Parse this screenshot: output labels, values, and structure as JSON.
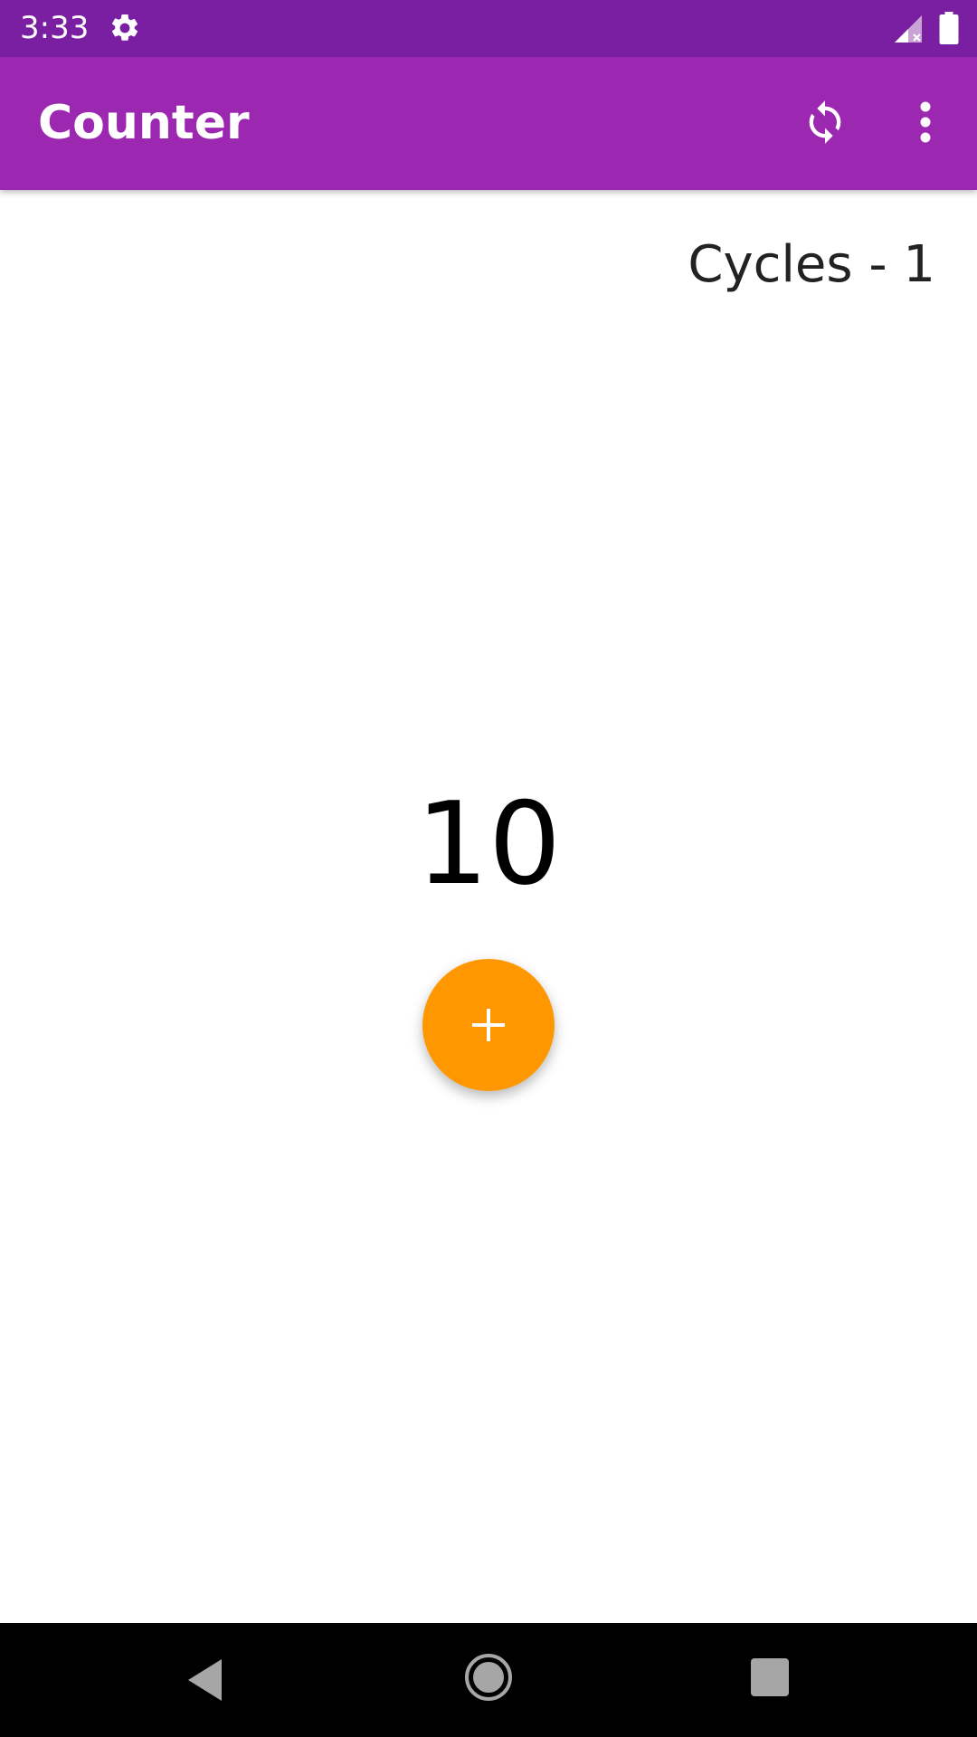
{
  "status_bar": {
    "time": "3:33",
    "icons": [
      "gear-icon",
      "signal-icon",
      "battery-icon"
    ]
  },
  "app_bar": {
    "title": "Counter",
    "actions": [
      "refresh-icon",
      "overflow-menu-icon"
    ]
  },
  "content": {
    "cycles_label": "Cycles - 1",
    "counter_value": "10",
    "fab_icon": "plus-icon"
  },
  "nav_bar": {
    "buttons": [
      "back-icon",
      "home-icon",
      "recents-icon"
    ]
  },
  "colors": {
    "status_bar": "#7b1fa2",
    "app_bar": "#9c27b0",
    "fab": "#ff9800",
    "nav_bar": "#000000"
  }
}
